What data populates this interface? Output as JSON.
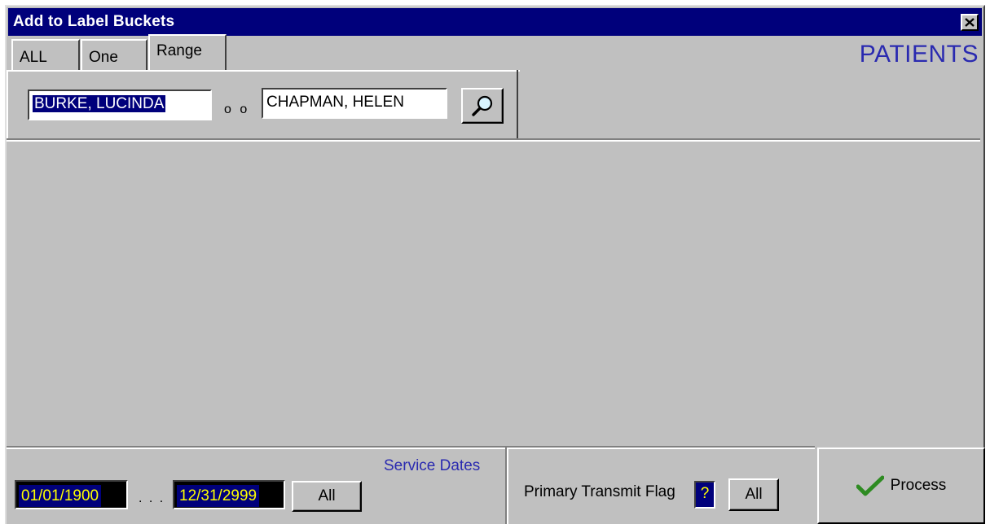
{
  "window": {
    "title": "Add to Label Buckets"
  },
  "header": {
    "section_label": "PATIENTS",
    "tabs": [
      {
        "label": "ALL"
      },
      {
        "label": "One"
      },
      {
        "label": "Range"
      }
    ],
    "active_tab": "Range"
  },
  "range": {
    "from_value": "BURKE, LUCINDA",
    "separator": "o o",
    "to_value": "CHAPMAN, HELEN",
    "search_icon": "magnifier-icon"
  },
  "service_dates": {
    "label": "Service Dates",
    "from_date": "01/01/1900",
    "separator": ". . .",
    "to_date": "12/31/2999",
    "all_button": "All"
  },
  "transmit_flag": {
    "label": "Primary Transmit Flag",
    "value": "?",
    "all_button": "All"
  },
  "process": {
    "label": "Process",
    "icon": "checkmark-icon",
    "icon_color": "#2e8b22"
  },
  "colors": {
    "titlebar": "#00007b",
    "accent_text": "#2a2ab0",
    "field_highlight": "#00007b",
    "date_text": "#ffff00"
  }
}
